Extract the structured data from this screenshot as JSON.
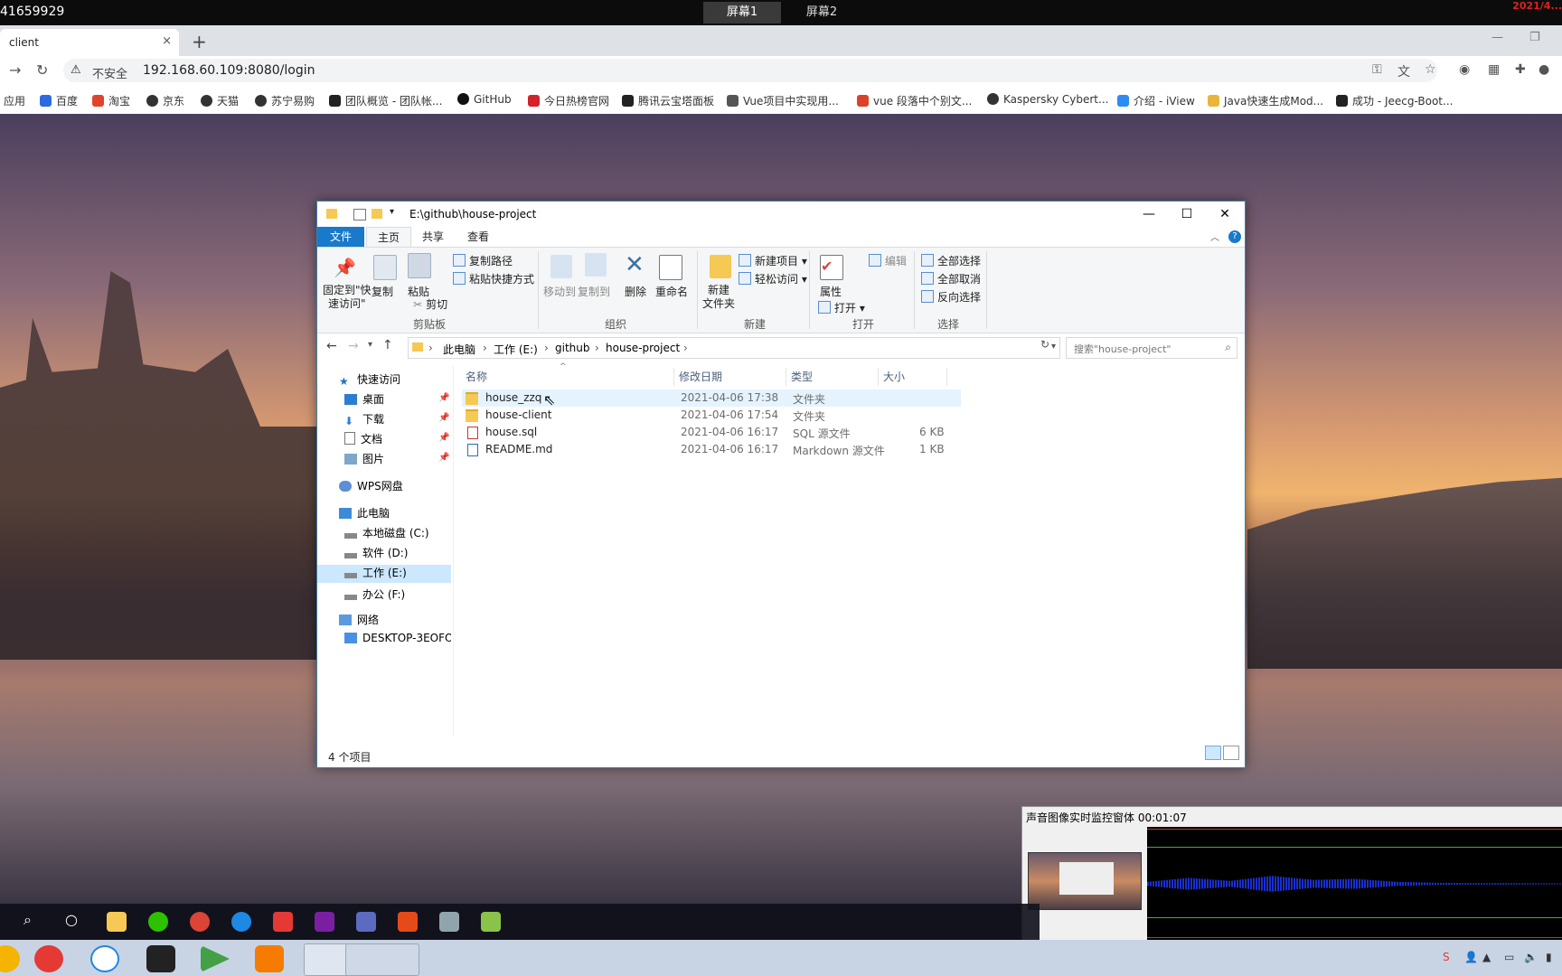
{
  "remote": {
    "session_id": "41659929",
    "tabs": [
      "屏幕1",
      "屏幕2"
    ],
    "date": "2021/4..."
  },
  "browser": {
    "tab_title": "client",
    "tab_close": "×",
    "new_tab": "+",
    "security_label": "不安全",
    "url": "192.168.60.109:8080/login",
    "bookmarks": [
      "应用",
      "百度",
      "淘宝",
      "京东",
      "天猫",
      "苏宁易购",
      "团队概览 - 团队帐...",
      "GitHub",
      "今日热榜官网",
      "腾讯云宝塔面板",
      "Vue项目中实现用...",
      "vue 段落中个别文...",
      "Kaspersky Cybert...",
      "介绍 - iView",
      "Java快速生成Mod...",
      "成功 - Jeecg-Boot..."
    ]
  },
  "explorer": {
    "title_path": "E:\\github\\house-project",
    "ribbon_tabs": [
      "文件",
      "主页",
      "共享",
      "查看"
    ],
    "clipboard": {
      "pin": "固定到\"快\n速访问\"",
      "copy": "复制",
      "paste": "粘贴",
      "copy_path": "复制路径",
      "paste_shortcut": "粘贴快捷方式",
      "cut": "剪切",
      "group": "剪贴板"
    },
    "organize": {
      "move_to": "移动到",
      "copy_to": "复制到",
      "delete": "删除",
      "rename": "重命名",
      "group": "组织"
    },
    "new": {
      "new_folder": "新建\n文件夹",
      "new_item": "新建项目",
      "easy_access": "轻松访问",
      "group": "新建"
    },
    "open": {
      "properties": "属性",
      "open": "打开",
      "edit": "编辑",
      "group": "打开"
    },
    "select": {
      "select_all": "全部选择",
      "select_none": "全部取消",
      "invert": "反向选择",
      "group": "选择"
    },
    "breadcrumbs": [
      "此电脑",
      "工作 (E:)",
      "github",
      "house-project"
    ],
    "search_placeholder": "搜索\"house-project\"",
    "nav": {
      "quick_access": "快速访问",
      "desktop": "桌面",
      "downloads": "下载",
      "documents": "文档",
      "pictures": "图片",
      "wps": "WPS网盘",
      "this_pc": "此电脑",
      "drive_c": "本地磁盘 (C:)",
      "drive_d": "软件 (D:)",
      "drive_e": "工作 (E:)",
      "drive_f": "办公 (F:)",
      "network": "网络",
      "desktop_pc": "DESKTOP-3EOFO("
    },
    "columns": [
      "名称",
      "修改日期",
      "类型",
      "大小"
    ],
    "files": [
      {
        "name": "house_zzq",
        "date": "2021-04-06 17:38",
        "type": "文件夹",
        "size": ""
      },
      {
        "name": "house-client",
        "date": "2021-04-06 17:54",
        "type": "文件夹",
        "size": ""
      },
      {
        "name": "house.sql",
        "date": "2021-04-06 16:17",
        "type": "SQL 源文件",
        "size": "6 KB"
      },
      {
        "name": "README.md",
        "date": "2021-04-06 16:17",
        "type": "Markdown 源文件",
        "size": "1 KB"
      }
    ],
    "status": "4 个项目"
  },
  "monitor": {
    "title": "声音图像实时监控窗体 00:01:07"
  }
}
